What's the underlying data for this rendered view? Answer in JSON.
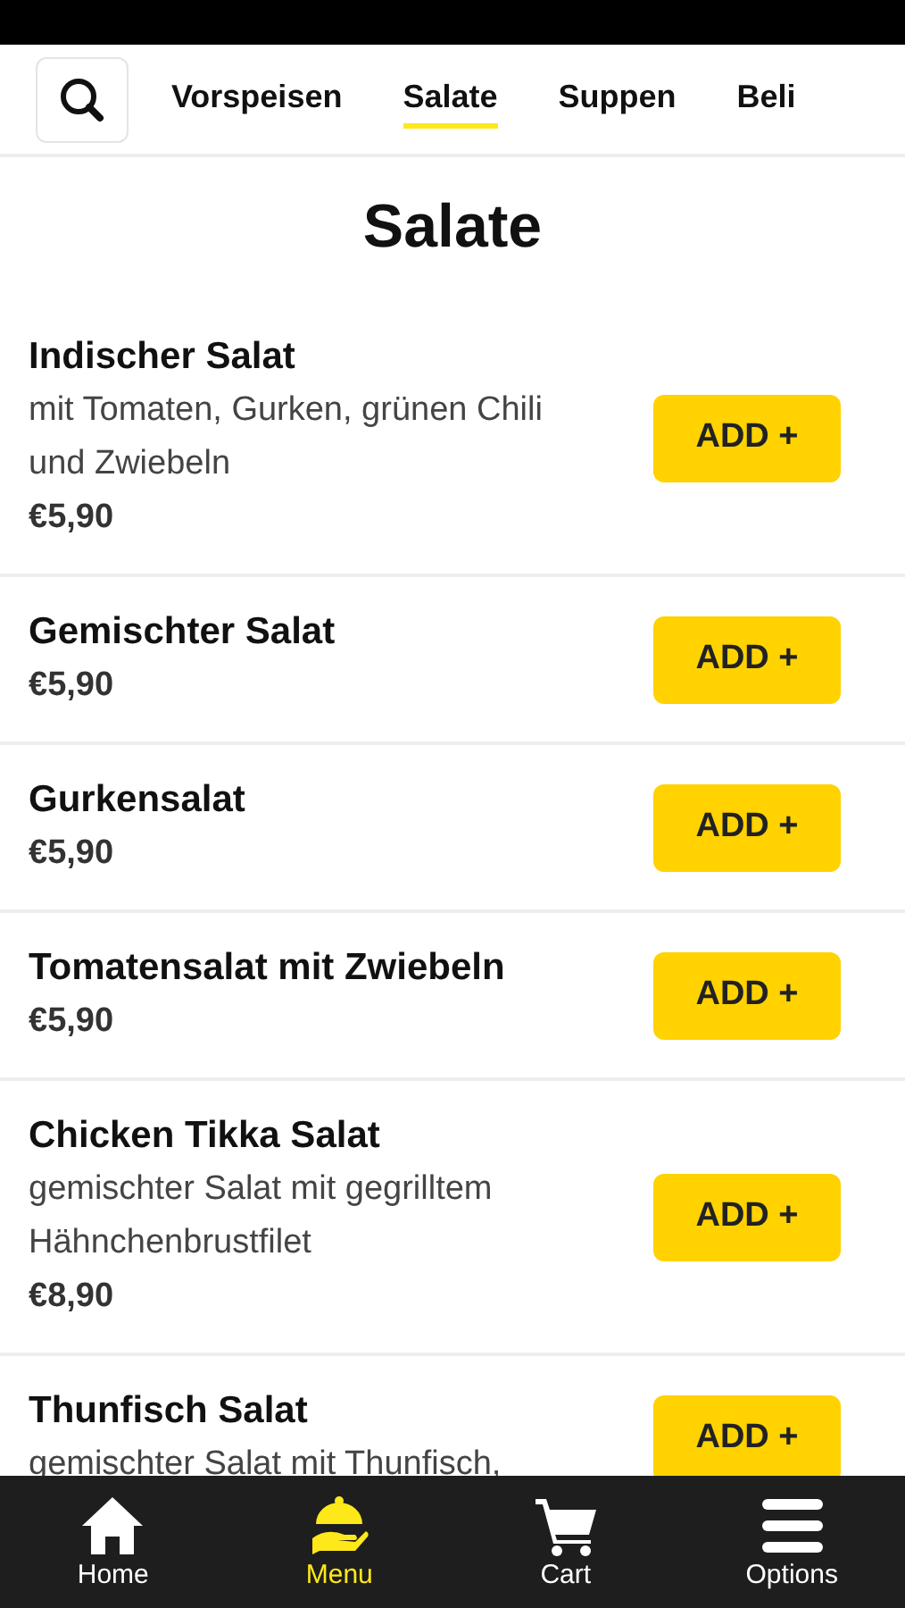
{
  "tabs": [
    {
      "label": "Vorspeisen",
      "selected": false
    },
    {
      "label": "Salate",
      "selected": true
    },
    {
      "label": "Suppen",
      "selected": false
    },
    {
      "label": "Beli",
      "selected": false
    }
  ],
  "section_title": "Salate",
  "items": [
    {
      "name": "Indischer Salat",
      "description": "mit Tomaten, Gurken, grünen Chili und Zwiebeln",
      "price": "€5,90",
      "button": "ADD +"
    },
    {
      "name": "Gemischter Salat",
      "price": "€5,90",
      "button": "ADD +"
    },
    {
      "name": "Gurkensalat",
      "price": "€5,90",
      "button": "ADD +"
    },
    {
      "name": "Tomatensalat mit Zwiebeln",
      "price": "€5,90",
      "button": "ADD +"
    },
    {
      "name": "Chicken Tikka Salat",
      "description": "gemischter Salat mit gegrilltem Hähnchenbrustfilet",
      "price": "€8,90",
      "button": "ADD +"
    },
    {
      "name": "Thunfisch Salat",
      "description": "gemischter Salat mit Thunfisch,",
      "button": "ADD +"
    }
  ],
  "bottom_nav": [
    {
      "kind": "home",
      "label": "Home",
      "selected": false
    },
    {
      "kind": "menu",
      "label": "Menu",
      "selected": true
    },
    {
      "kind": "cart",
      "label": "Cart",
      "selected": false
    },
    {
      "kind": "options",
      "label": "Options",
      "selected": false
    }
  ]
}
